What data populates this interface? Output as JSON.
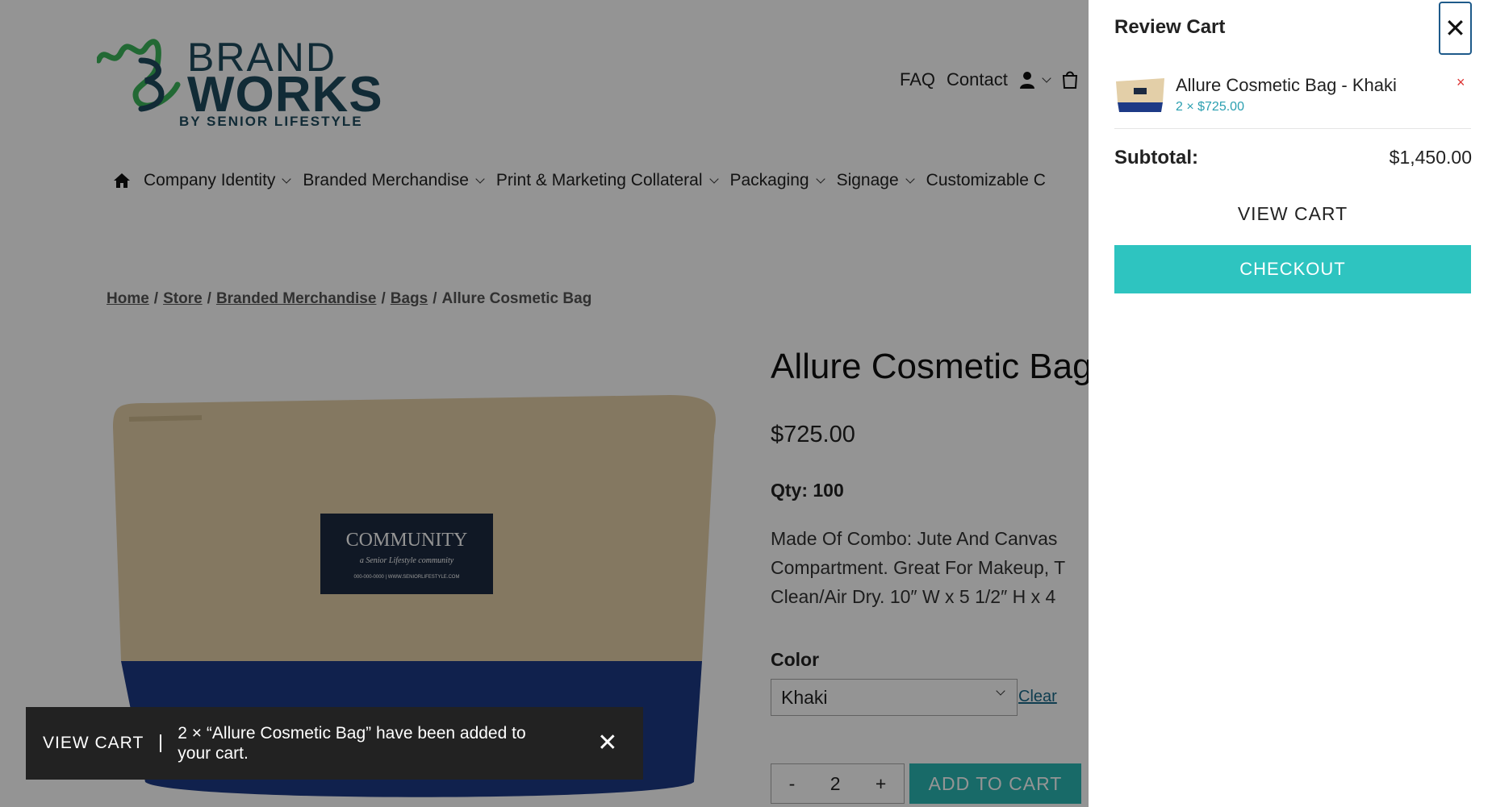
{
  "logo": {
    "brand": "BRAND",
    "works": "WORKS",
    "tagline": "BY SENIOR LIFESTYLE"
  },
  "header": {
    "faq": "FAQ",
    "contact": "Contact",
    "user_icon": "user-icon",
    "cart_icon": "cart-icon"
  },
  "nav": {
    "home_icon": "home-icon",
    "items": [
      {
        "label": "Company Identity"
      },
      {
        "label": "Branded Merchandise"
      },
      {
        "label": "Print & Marketing Collateral"
      },
      {
        "label": "Packaging"
      },
      {
        "label": "Signage"
      },
      {
        "label": "Customizable C"
      }
    ]
  },
  "breadcrumb": {
    "items": [
      "Home",
      "Store",
      "Branded Merchandise",
      "Bags"
    ],
    "current": "Allure Cosmetic Bag"
  },
  "product": {
    "title": "Allure Cosmetic Bag",
    "price": "$725.00",
    "qty_label": "Qty: 100",
    "desc_lines": [
      "Made Of Combo: Jute And Canvas",
      "Compartment. Great For Makeup, T",
      "Clean/Air Dry. 10″ W x 5 1/2″ H x 4"
    ],
    "color_label": "Color",
    "color_value": "Khaki",
    "clear_label": "Clear",
    "qty_minus": "-",
    "qty_value": "2",
    "qty_plus": "+",
    "add_to_cart": "ADD TO CART",
    "patch_text": "COMMUNITY",
    "patch_sub": "a Senior Lifestyle community",
    "patch_small": "000-000-0000 | WWW.SENIORLIFESTYLE.COM"
  },
  "toast": {
    "view_cart": "VIEW CART",
    "message": "2 × “Allure Cosmetic Bag” have been added to your cart.",
    "close": "✕"
  },
  "cart": {
    "title": "Review Cart",
    "close": "✕",
    "item_name": "Allure Cosmetic Bag - Khaki",
    "item_meta": "2 × $725.00",
    "remove": "×",
    "subtotal_label": "Subtotal:",
    "subtotal_value": "$1,450.00",
    "view_cart": "VIEW CART",
    "checkout": "CHECKOUT"
  },
  "colors": {
    "brand_teal": "#2ab7b3",
    "brand_navy": "#1e4a5e",
    "logo_green": "#3bb65a"
  }
}
